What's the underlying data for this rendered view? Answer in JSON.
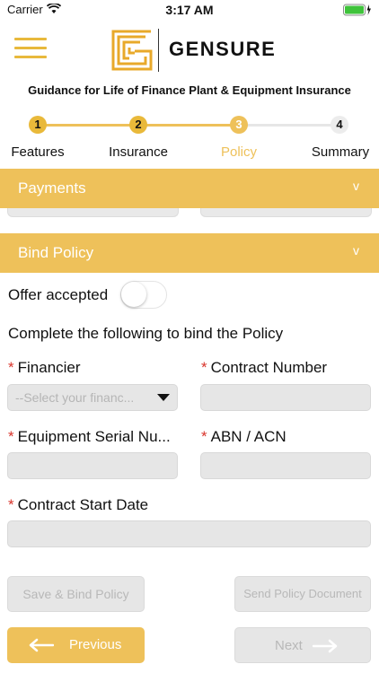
{
  "status_bar": {
    "carrier": "Carrier",
    "time": "3:17 AM"
  },
  "header": {
    "brand": "GENSURE"
  },
  "subtitle": "Guidance for Life of Finance Plant & Equipment Insurance",
  "steps": [
    {
      "number": "1",
      "label": "Features",
      "state": "done"
    },
    {
      "number": "2",
      "label": "Insurance",
      "state": "done"
    },
    {
      "number": "3",
      "label": "Policy",
      "state": "current"
    },
    {
      "number": "4",
      "label": "Summary",
      "state": "upcoming"
    }
  ],
  "sections": {
    "payments": {
      "title": "Payments",
      "chevron": "v"
    },
    "bind_policy": {
      "title": "Bind Policy",
      "chevron": "v"
    }
  },
  "bind": {
    "offer_label": "Offer accepted",
    "offer_accepted": false,
    "instructions": "Complete the following to bind the Policy",
    "required_mark": "*",
    "financier_label": "Financier",
    "financier_placeholder": "--Select your financ...",
    "contract_number_label": "Contract Number",
    "equipment_serial_label": "Equipment Serial Nu...",
    "abn_acn_label": "ABN / ACN",
    "contract_start_label": "Contract Start Date"
  },
  "actions": {
    "save_bind": "Save & Bind Policy",
    "send_document": "Send Policy Document",
    "previous": "Previous",
    "next": "Next"
  },
  "colors": {
    "accent": "#eec15a",
    "inactive": "#e6e6e6",
    "required": "#d9342b"
  }
}
